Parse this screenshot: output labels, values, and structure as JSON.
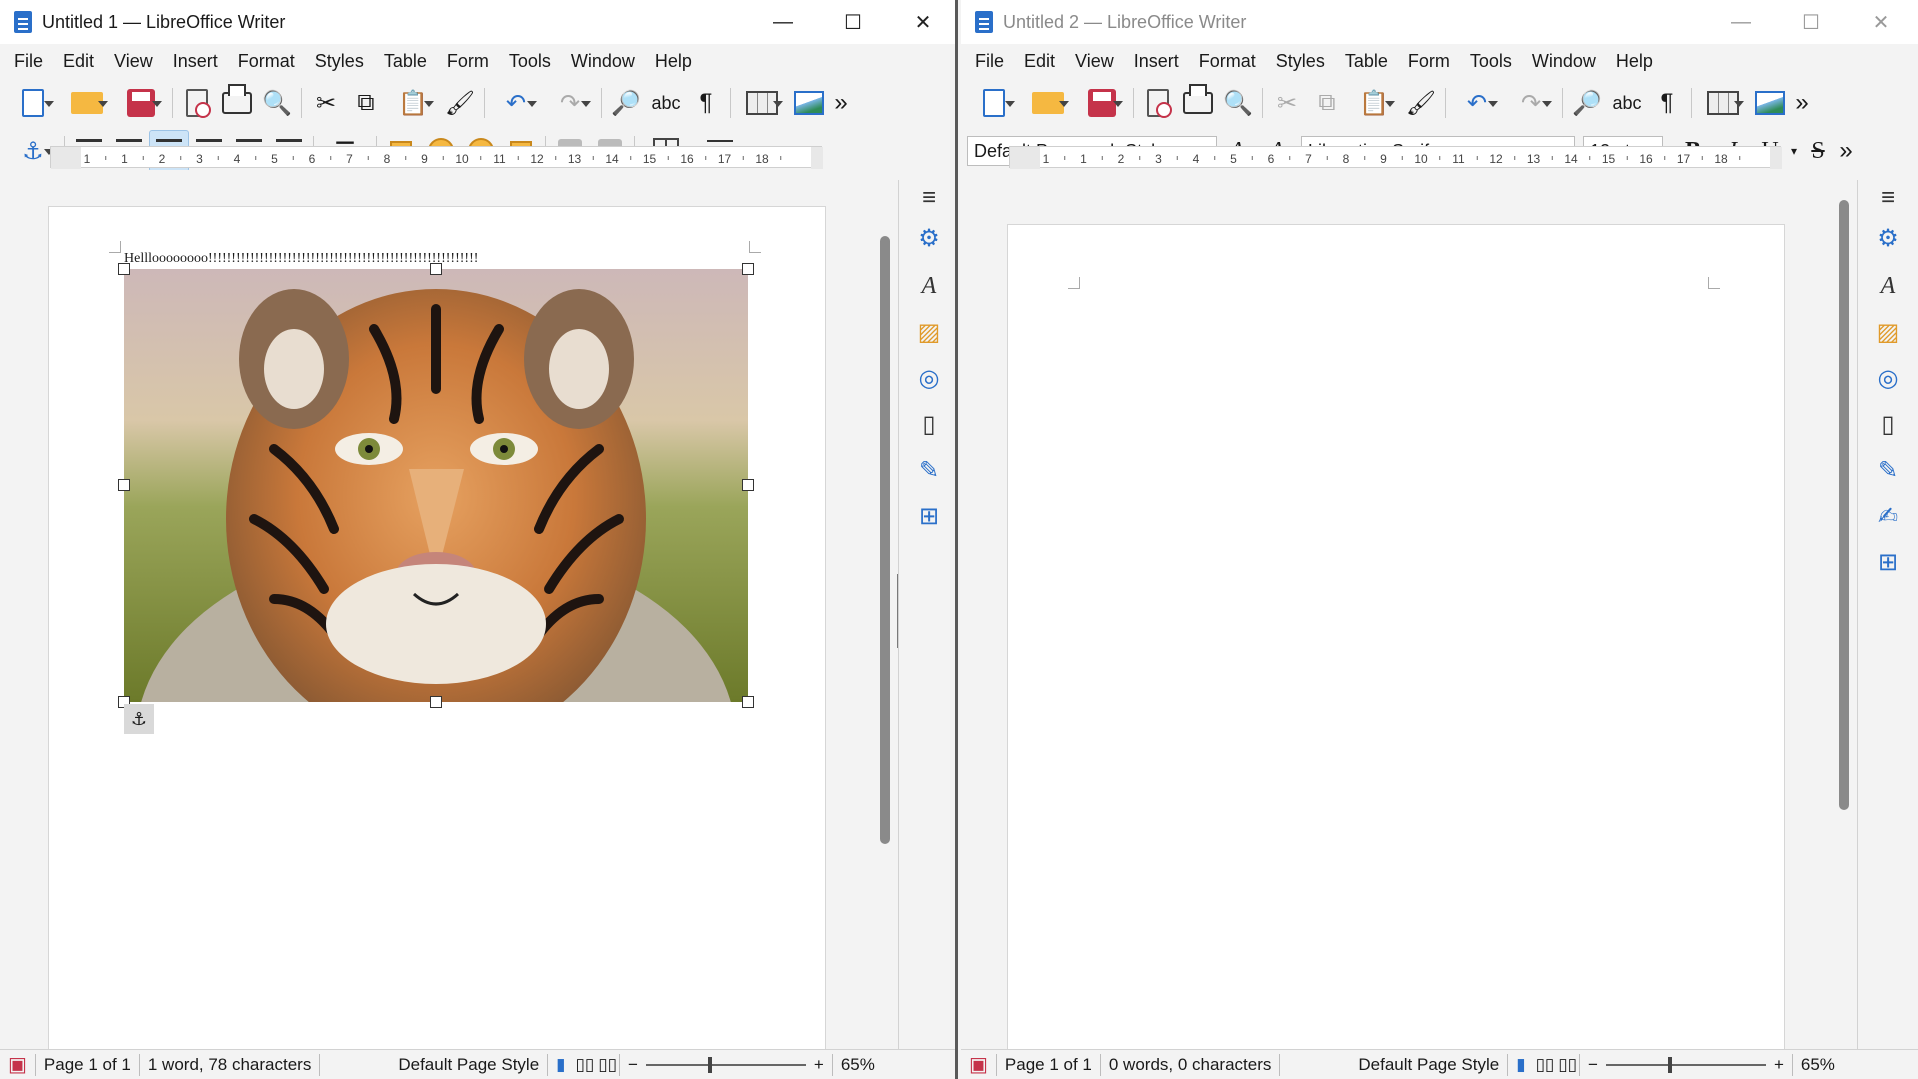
{
  "window1": {
    "title": "Untitled 1 — LibreOffice Writer",
    "menu": [
      "File",
      "Edit",
      "View",
      "Insert",
      "Format",
      "Styles",
      "Table",
      "Form",
      "Tools",
      "Window",
      "Help"
    ],
    "document_text": "Hellloooooooo!!!!!!!!!!!!!!!!!!!!!!!!!!!!!!!!!!!!!!!!!!!!!!!!!!!!!!!!!!",
    "image_subject": "tiger-photo",
    "status": {
      "page": "Page 1 of 1",
      "words": "1 word, 78 characters",
      "page_style": "Default Page Style",
      "zoom": "65%"
    },
    "ruler_ticks": [
      "1",
      "1",
      "2",
      "3",
      "4",
      "5",
      "6",
      "7",
      "8",
      "9",
      "10",
      "11",
      "12",
      "13",
      "14",
      "15",
      "16",
      "17",
      "18"
    ]
  },
  "window2": {
    "title": "Untitled 2 — LibreOffice Writer",
    "menu": [
      "File",
      "Edit",
      "View",
      "Insert",
      "Format",
      "Styles",
      "Table",
      "Form",
      "Tools",
      "Window",
      "Help"
    ],
    "paragraph_style": "Default Paragraph Style",
    "font_name": "Liberation Serif",
    "font_size": "12 pt",
    "status": {
      "page": "Page 1 of 1",
      "words": "0 words, 0 characters",
      "page_style": "Default Page Style",
      "zoom": "65%"
    },
    "ruler_ticks": [
      "1",
      "1",
      "2",
      "3",
      "4",
      "5",
      "6",
      "7",
      "8",
      "9",
      "10",
      "11",
      "12",
      "13",
      "14",
      "15",
      "16",
      "17",
      "18"
    ]
  },
  "colors": {
    "accent": "#2a6fc9",
    "save_red": "#c5334a",
    "folder": "#f5b841"
  }
}
